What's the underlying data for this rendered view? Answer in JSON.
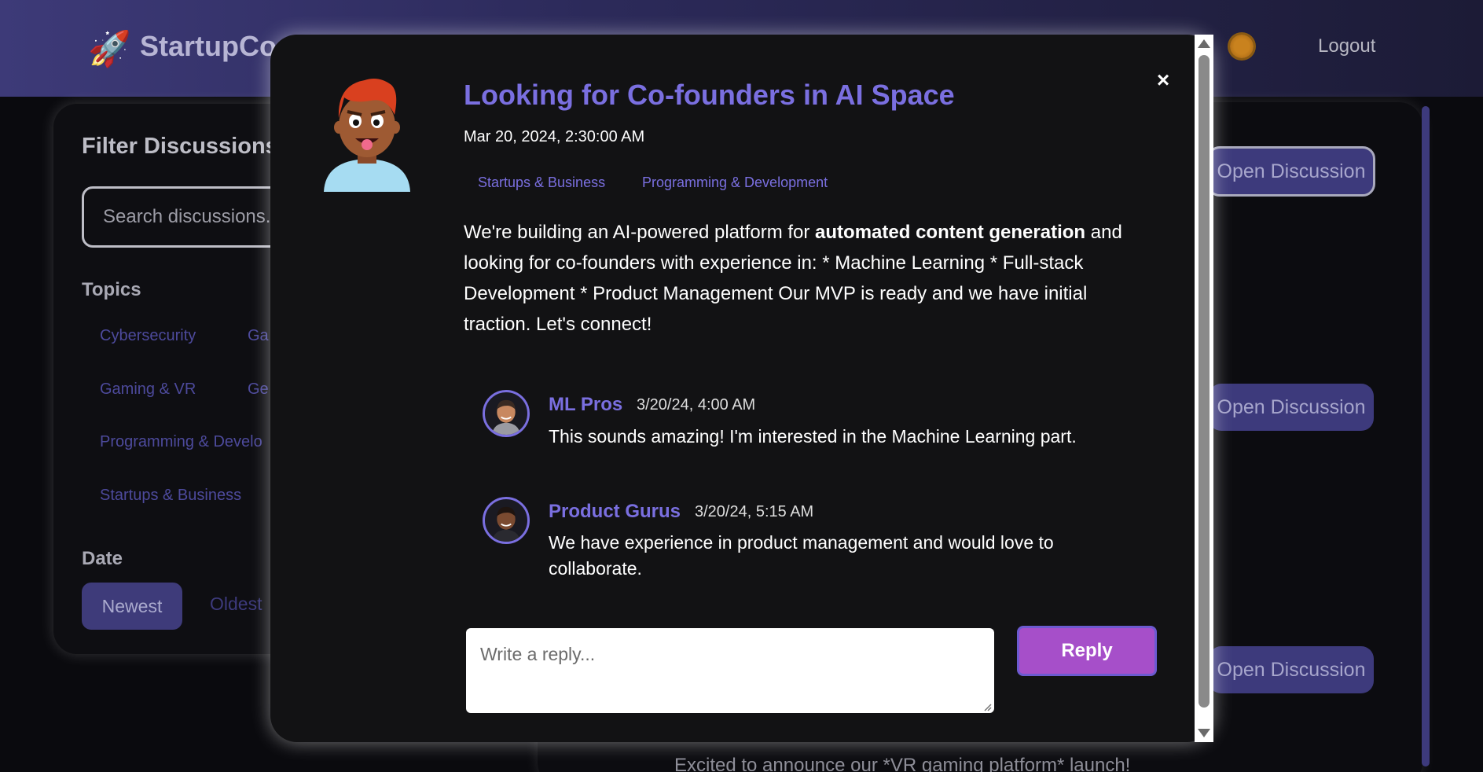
{
  "header": {
    "logo_icon": "rocket-icon",
    "app_name": "StartupCo",
    "theme_icon": "sun-icon",
    "logout_label": "Logout"
  },
  "filters": {
    "title": "Filter Discussions",
    "search_placeholder": "Search discussions...",
    "topics_label": "Topics",
    "topics": [
      "Cybersecurity",
      "Ga",
      "Gaming & VR",
      "Ge",
      "Programming & Develo",
      "Startups & Business"
    ],
    "date_label": "Date",
    "newest_label": "Newest",
    "oldest_label": "Oldest"
  },
  "feed": {
    "open_label": "Open Discussion",
    "bottom_snippet": "Excited to announce our *VR gaming platform* launch!",
    "accent_color": "#3d3a7c"
  },
  "modal": {
    "title": "Looking for Co-founders in AI Space",
    "date": "Mar 20, 2024, 2:30:00 AM",
    "tags": [
      "Startups & Business",
      "Programming & Development"
    ],
    "body": {
      "part1": "We're building an AI-powered platform for ",
      "bold": "automated content generation",
      "part2": " and looking for co-founders with experience in: * Machine Learning * Full-stack Development * Product Management Our MVP is ready and we have initial traction. Let's connect!"
    },
    "close_label": "×",
    "comments": [
      {
        "author": "ML Pros",
        "time": "3/20/24, 4:00 AM",
        "text": "This sounds amazing! I'm interested in the Machine Learning part."
      },
      {
        "author": "Product Gurus",
        "time": "3/20/24, 5:15 AM",
        "text": "We have experience in product management and would love to collaborate."
      }
    ],
    "reply_placeholder": "Write a reply...",
    "reply_label": "Reply",
    "accent_color": "#7a6fe0",
    "reply_color": "#a64fc9"
  }
}
